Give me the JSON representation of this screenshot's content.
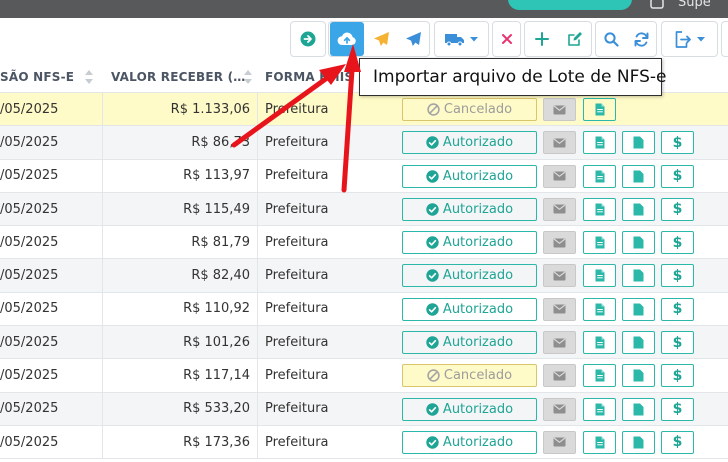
{
  "header": {
    "app_title": "Supe",
    "accent_pill_color": "#2ec4b6"
  },
  "toolbar": {
    "icons": [
      "arrow-right-circle-icon",
      "cloud-upload-icon",
      "send-yellow-icon",
      "send-blue-icon",
      "truck-icon",
      "close-icon",
      "plus-icon",
      "edit-icon",
      "search-icon",
      "refresh-icon",
      "export-icon"
    ],
    "active_color": "#3aa6e8"
  },
  "tooltip": {
    "text": "Importar arquivo de Lote de NFS-e"
  },
  "table": {
    "columns": [
      {
        "label": "SÃO NFS-E"
      },
      {
        "label": "VALOR RECEBER (…"
      },
      {
        "label": "FORMA EMIS"
      }
    ],
    "rows": [
      {
        "date": "/05/2025",
        "value": "R$ 1.133,06",
        "form": "Prefeitura",
        "status": "Cancelado",
        "state": "cancel"
      },
      {
        "date": "/05/2025",
        "value": "R$ 86,73",
        "form": "Prefeitura",
        "status": "Autorizado",
        "state": "ok"
      },
      {
        "date": "/05/2025",
        "value": "R$ 113,97",
        "form": "Prefeitura",
        "status": "Autorizado",
        "state": "ok"
      },
      {
        "date": "/05/2025",
        "value": "R$ 115,49",
        "form": "Prefeitura",
        "status": "Autorizado",
        "state": "ok"
      },
      {
        "date": "/05/2025",
        "value": "R$ 81,79",
        "form": "Prefeitura",
        "status": "Autorizado",
        "state": "ok"
      },
      {
        "date": "/05/2025",
        "value": "R$ 82,40",
        "form": "Prefeitura",
        "status": "Autorizado",
        "state": "ok"
      },
      {
        "date": "/05/2025",
        "value": "R$ 110,92",
        "form": "Prefeitura",
        "status": "Autorizado",
        "state": "ok"
      },
      {
        "date": "/05/2025",
        "value": "R$ 101,26",
        "form": "Prefeitura",
        "status": "Autorizado",
        "state": "ok"
      },
      {
        "date": "/05/2025",
        "value": "R$ 117,14",
        "form": "Prefeitura",
        "status": "Cancelado",
        "state": "cancel"
      },
      {
        "date": "/05/2025",
        "value": "R$ 533,20",
        "form": "Prefeitura",
        "status": "Autorizado",
        "state": "ok"
      },
      {
        "date": "/05/2025",
        "value": "R$ 173,36",
        "form": "Prefeitura",
        "status": "Autorizado",
        "state": "ok"
      }
    ],
    "pdf_label": "PDF",
    "money_symbol": "$",
    "status_ok_color": "#1fa595",
    "highlight_color": "#fffbc8"
  },
  "annotation": {
    "arrow_color": "#e8141c"
  }
}
